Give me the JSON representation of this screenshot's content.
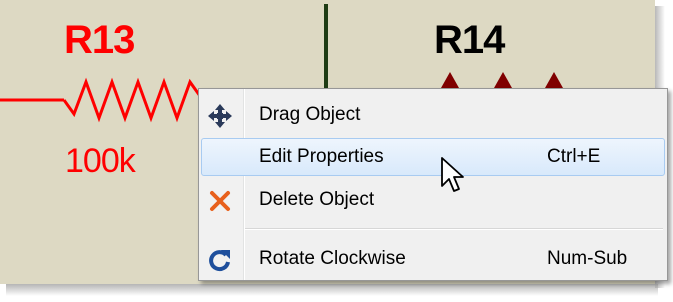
{
  "schematic": {
    "components": [
      {
        "reference": "R13",
        "value": "100k",
        "color": "#ff0000"
      },
      {
        "reference": "R14",
        "value": "",
        "color": "#000000"
      }
    ],
    "wire_color": "#ff0000",
    "bus_color": "#1e3c14",
    "pin_marker_color": "#800000",
    "background": "#ddd9c3"
  },
  "context_menu": {
    "items": [
      {
        "label": "Drag Object",
        "shortcut": "",
        "icon": "move-arrows-icon"
      },
      {
        "label": "Edit Properties",
        "shortcut": "Ctrl+E",
        "icon": "",
        "highlighted": true
      },
      {
        "label": "Delete Object",
        "shortcut": "",
        "icon": "delete-x-icon"
      },
      {
        "label": "Rotate Clockwise",
        "shortcut": "Num-Sub",
        "icon": "rotate-clockwise-icon"
      }
    ],
    "highlight_color": "#d8e9fb"
  },
  "cursor": {
    "icon": "arrow-pointer-icon"
  }
}
